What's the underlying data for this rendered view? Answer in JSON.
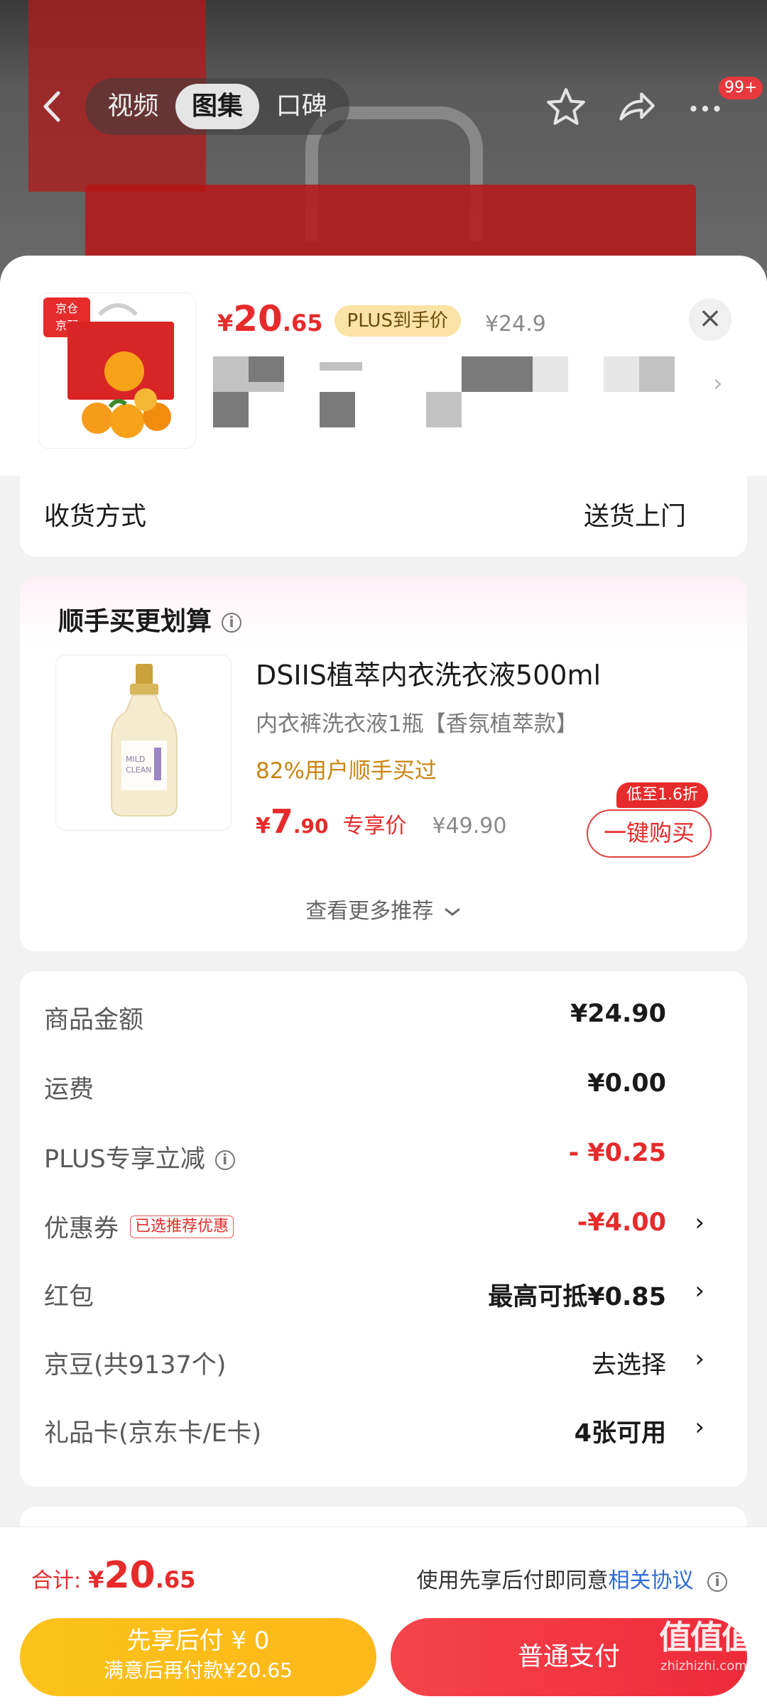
{
  "hero": {
    "tabs": [
      "视频",
      "图集",
      "口碑"
    ],
    "active_tab": "图集",
    "cart_badge": "99+"
  },
  "product": {
    "store_tag_line1": "京仓",
    "store_tag_line2": "京配",
    "price_symbol": "¥",
    "price_int": "20",
    "price_dec": ".65",
    "plus_tag": "PLUS到手价",
    "original_price": "¥24.9",
    "close": "×"
  },
  "shipping": {
    "label": "收货方式",
    "value": "送货上门"
  },
  "recommend": {
    "title": "顺手买更划算",
    "item_name": "DSIIS植萃内衣洗衣液500ml",
    "item_sub": "内衣裤洗衣液1瓶【香氛植萃款】",
    "item_hot": "82%用户顺手买过",
    "price_symbol": "¥",
    "price_int": "7",
    "price_dec": ".90",
    "price_label": "专享价",
    "old_price": "¥49.90",
    "badge": "低至1.6折",
    "buy_button": "一键购买",
    "more": "查看更多推荐"
  },
  "summary": {
    "rows": [
      {
        "label": "商品金额",
        "value": "¥24.90"
      },
      {
        "label": "运费",
        "value": "¥0.00"
      },
      {
        "label": "PLUS专享立减",
        "value": "- ¥0.25"
      },
      {
        "label": "优惠券",
        "tag": "已选推荐优惠",
        "value": "-¥4.00"
      },
      {
        "label": "红包",
        "value": "最高可抵¥0.85"
      },
      {
        "label": "京豆(共9137个)",
        "value": "去选择"
      },
      {
        "label": "礼品卡(京东卡/E卡)",
        "value": "4张可用"
      }
    ]
  },
  "bottom": {
    "total_label": "合计:",
    "total_symbol": "¥",
    "total_int": "20",
    "total_dec": ".65",
    "agree_text": "使用先享后付即同意",
    "agree_link": "相关协议",
    "pay_later_line1": "先享后付 ¥ 0",
    "pay_later_line2": "满意后再付款¥20.65",
    "pay_normal": "普通支付"
  },
  "watermark": {
    "logo": "值值值",
    "site": "zhizhizhi.com"
  },
  "colors": {
    "accent_red": "#e52b2b",
    "gold": "#fcc21a",
    "link_blue": "#2f6bd8"
  }
}
